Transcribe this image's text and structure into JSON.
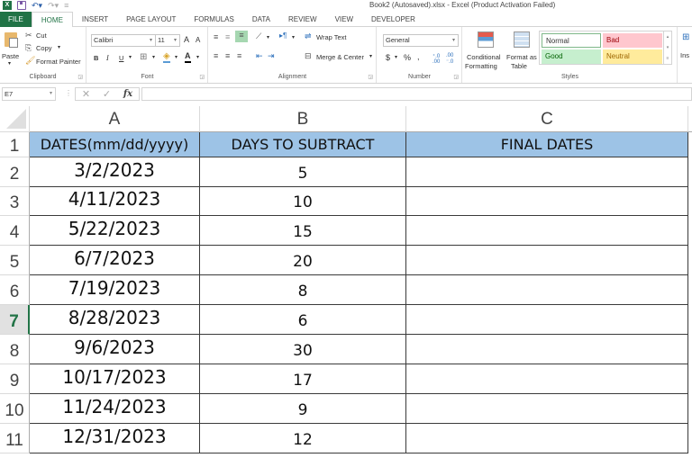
{
  "window": {
    "title": "Book2 (Autosaved).xlsx - Excel (Product Activation Failed)"
  },
  "quick_access": {
    "icons": [
      "excel-logo",
      "save-icon",
      "undo-icon",
      "redo-icon",
      "customize-icon"
    ]
  },
  "tabs": [
    {
      "label": "FILE"
    },
    {
      "label": "HOME"
    },
    {
      "label": "INSERT"
    },
    {
      "label": "PAGE LAYOUT"
    },
    {
      "label": "FORMULAS"
    },
    {
      "label": "DATA"
    },
    {
      "label": "REVIEW"
    },
    {
      "label": "VIEW"
    },
    {
      "label": "DEVELOPER"
    }
  ],
  "ribbon": {
    "clipboard": {
      "label": "Clipboard",
      "paste": "Paste",
      "cut": "Cut",
      "copy": "Copy",
      "format_painter": "Format Painter"
    },
    "font": {
      "label": "Font",
      "font_name": "Calibri",
      "font_size": "11",
      "bold": "B",
      "italic": "I",
      "underline": "U",
      "grow": "A",
      "shrink": "A"
    },
    "alignment": {
      "label": "Alignment",
      "wrap_text": "Wrap Text",
      "merge_center": "Merge & Center"
    },
    "number": {
      "label": "Number",
      "format": "General",
      "currency": "$",
      "percent": "%",
      "comma": ","
    },
    "styles": {
      "label": "Styles",
      "conditional_formatting_1": "Conditional",
      "conditional_formatting_2": "Formatting",
      "format_as_table_1": "Format as",
      "format_as_table_2": "Table",
      "normal": "Normal",
      "bad": "Bad",
      "good": "Good",
      "neutral": "Neutral"
    },
    "cells": {
      "insert": "Ins"
    }
  },
  "formula_bar": {
    "name_box": "E7",
    "formula": ""
  },
  "sheet": {
    "columns": [
      "A",
      "B",
      "C"
    ],
    "rows": [
      "1",
      "2",
      "3",
      "4",
      "5",
      "6",
      "7",
      "8",
      "9",
      "10",
      "11"
    ],
    "selected_row": "7",
    "header": [
      "DATES(mm/dd/yyyy)",
      "DAYS TO SUBTRACT",
      "FINAL DATES"
    ],
    "data": [
      {
        "date": "3/2/2023",
        "days": "5",
        "final": ""
      },
      {
        "date": "4/11/2023",
        "days": "10",
        "final": ""
      },
      {
        "date": "5/22/2023",
        "days": "15",
        "final": ""
      },
      {
        "date": "6/7/2023",
        "days": "20",
        "final": ""
      },
      {
        "date": "7/19/2023",
        "days": "8",
        "final": ""
      },
      {
        "date": "8/28/2023",
        "days": "6",
        "final": ""
      },
      {
        "date": "9/6/2023",
        "days": "30",
        "final": ""
      },
      {
        "date": "10/17/2023",
        "days": "17",
        "final": ""
      },
      {
        "date": "11/24/2023",
        "days": "9",
        "final": ""
      },
      {
        "date": "12/31/2023",
        "days": "12",
        "final": ""
      }
    ]
  },
  "colors": {
    "accent": "#217346",
    "header_fill": "#9dc3e6",
    "style_bad": "#ffc7ce",
    "style_good": "#c6efce",
    "style_neutral": "#ffeb9c"
  }
}
